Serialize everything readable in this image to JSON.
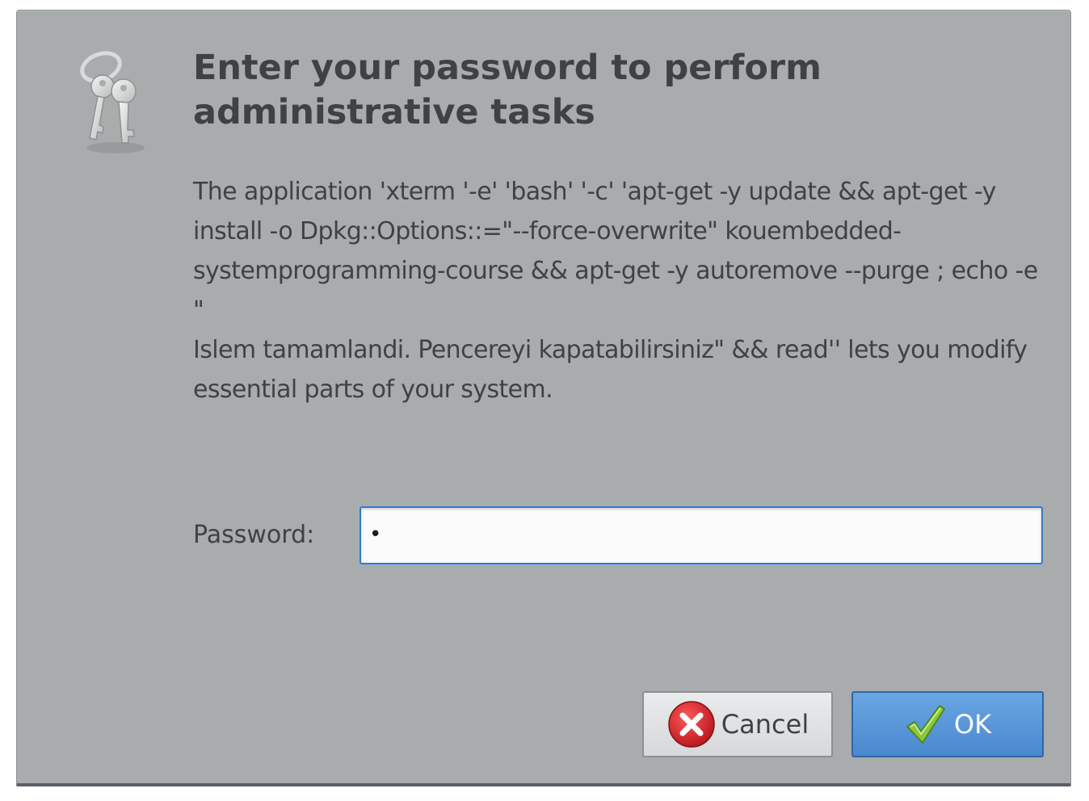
{
  "dialog": {
    "icon": "keys-icon",
    "title": "Enter your password to perform administrative tasks",
    "message": "The application 'xterm '-e' 'bash' '-c' 'apt-get -y update && apt-get -y install -o Dpkg::Options::=\"--force-overwrite\" kouembedded-systemprogramming-course && apt-get -y autoremove --purge  ; echo -e \"\nIslem tamamlandi. Pencereyi kapatabilirsiniz\" && read'' lets you modify essential parts of your system.",
    "password": {
      "label": "Password:",
      "value": "•"
    },
    "buttons": {
      "cancel": {
        "label": "Cancel",
        "icon": "cancel-icon"
      },
      "ok": {
        "label": "OK",
        "icon": "checkmark-icon"
      }
    }
  },
  "colors": {
    "dialog_background": "#a8acac",
    "text": "#3f4244",
    "ok_button": "#4a88cf",
    "focus_border": "#3b78c0",
    "cancel_icon_red": "#d8232a",
    "checkmark_green": "#8cc63f"
  }
}
